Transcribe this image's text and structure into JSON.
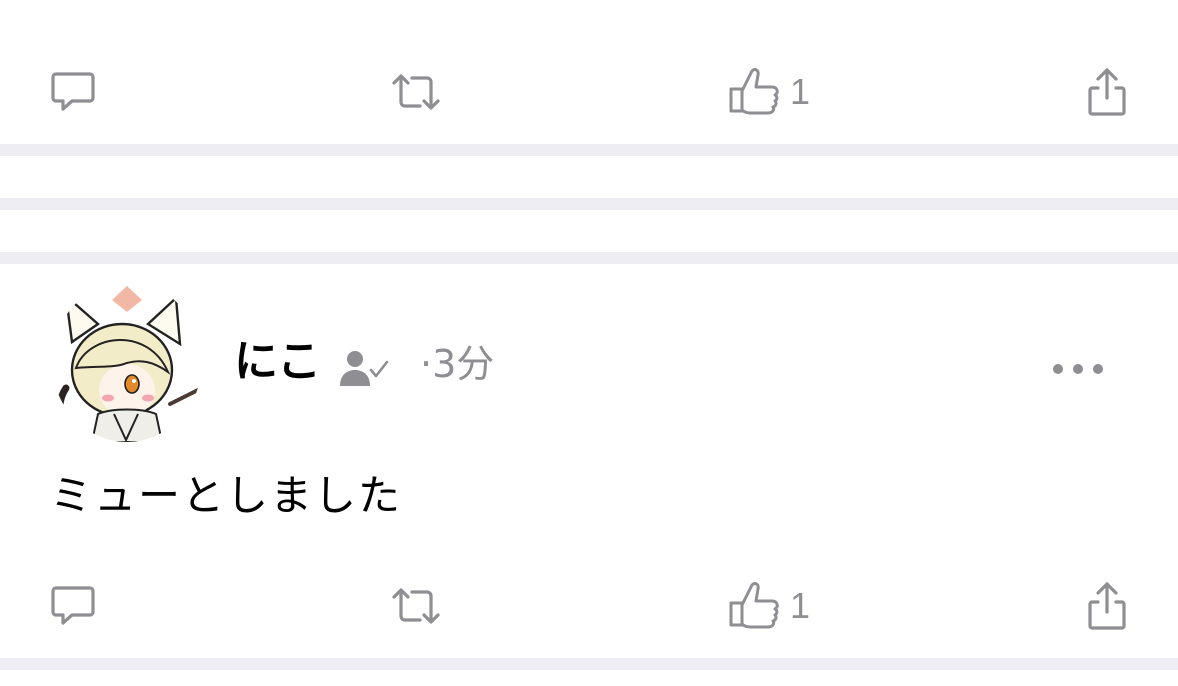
{
  "top_post": {
    "actions": {
      "reply_icon": "speech-bubble-icon",
      "renote_icon": "repost-icon",
      "reaction_icon": "thumbs-up-icon",
      "reaction_count": "1",
      "share_icon": "share-icon"
    }
  },
  "post": {
    "author_name": "にこ",
    "follow_status_icon": "person-check-icon",
    "timestamp": "·3分",
    "text": "ミューとしました",
    "more_icon": "ellipsis-icon",
    "actions": {
      "reply_icon": "speech-bubble-icon",
      "renote_icon": "repost-icon",
      "reaction_icon": "thumbs-up-icon",
      "reaction_count": "1",
      "share_icon": "share-icon"
    }
  },
  "colors": {
    "separator": "#eeedf3",
    "icon_gray": "#8e8e93",
    "text": "#000000"
  }
}
